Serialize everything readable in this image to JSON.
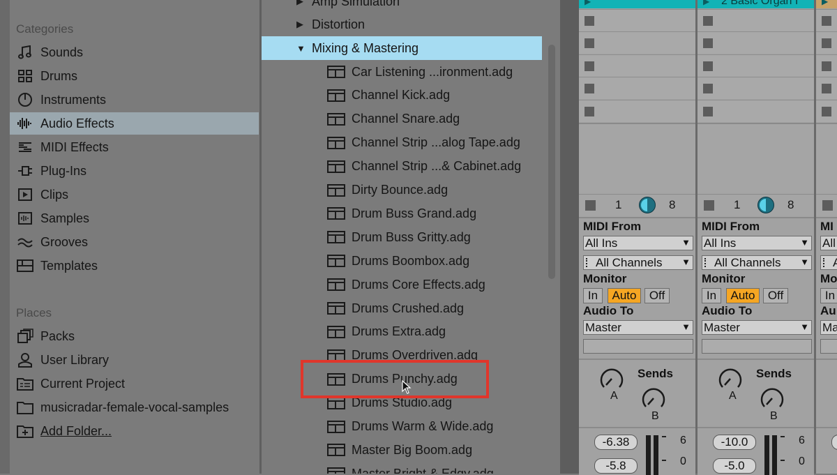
{
  "categories": {
    "heading": "Categories",
    "items": [
      {
        "label": "Sounds",
        "icon": "sounds-icon"
      },
      {
        "label": "Drums",
        "icon": "drums-icon"
      },
      {
        "label": "Instruments",
        "icon": "instruments-icon"
      },
      {
        "label": "Audio Effects",
        "icon": "audio-effects-icon",
        "selected": true
      },
      {
        "label": "MIDI Effects",
        "icon": "midi-effects-icon"
      },
      {
        "label": "Plug-Ins",
        "icon": "plugins-icon"
      },
      {
        "label": "Clips",
        "icon": "clips-icon"
      },
      {
        "label": "Samples",
        "icon": "samples-icon"
      },
      {
        "label": "Grooves",
        "icon": "grooves-icon"
      },
      {
        "label": "Templates",
        "icon": "templates-icon"
      }
    ]
  },
  "places": {
    "heading": "Places",
    "items": [
      {
        "label": "Packs",
        "icon": "packs-icon"
      },
      {
        "label": "User Library",
        "icon": "user-library-icon"
      },
      {
        "label": "Current Project",
        "icon": "current-project-icon"
      },
      {
        "label": "musicradar-female-vocal-samples",
        "icon": "folder-icon"
      },
      {
        "label": "Add Folder...",
        "icon": "add-folder-icon"
      }
    ]
  },
  "browser": {
    "folders": [
      {
        "label": "Amp Simulation",
        "expanded": false
      },
      {
        "label": "Distortion",
        "expanded": false
      },
      {
        "label": "Mixing & Mastering",
        "expanded": true,
        "selected": true
      }
    ],
    "files": [
      "Car Listening ...ironment.adg",
      "Channel Kick.adg",
      "Channel Snare.adg",
      "Channel Strip ...alog Tape.adg",
      "Channel Strip ...& Cabinet.adg",
      "Dirty Bounce.adg",
      "Drum Buss Grand.adg",
      "Drum Buss Gritty.adg",
      "Drums Boombox.adg",
      "Drums Core Effects.adg",
      "Drums Crushed.adg",
      "Drums Extra.adg",
      "Drums Overdriven.adg",
      "Drums Punchy.adg",
      "Drums Studio.adg",
      "Drums Warm & Wide.adg",
      "Master Big Boom.adg",
      "Master Bright & Edgy.adg"
    ],
    "highlighted_file": "Drums Punchy.adg"
  },
  "tracks": [
    {
      "name": "",
      "header_color": "#12b3b6",
      "status_left": "1",
      "status_right": "8",
      "midi_from_label": "MIDI From",
      "midi_from_value": "All Ins",
      "channel_value": "All Channels",
      "monitor_label": "Monitor",
      "monitor_in": "In",
      "monitor_auto": "Auto",
      "monitor_off": "Off",
      "audio_to_label": "Audio To",
      "audio_to_value": "Master",
      "sends_label": "Sends",
      "send_a": "A",
      "send_b": "B",
      "volume": "-6.38",
      "volume2": "-5.8",
      "meter_top": "6",
      "meter_bottom": "0"
    },
    {
      "name": "2 Basic Organ I",
      "header_color": "#12b3b6",
      "status_left": "1",
      "status_right": "8",
      "midi_from_label": "MIDI From",
      "midi_from_value": "All Ins",
      "channel_value": "All Channels",
      "monitor_label": "Monitor",
      "monitor_in": "In",
      "monitor_auto": "Auto",
      "monitor_off": "Off",
      "audio_to_label": "Audio To",
      "audio_to_value": "Master",
      "sends_label": "Sends",
      "send_a": "A",
      "send_b": "B",
      "volume": "-10.0",
      "volume2": "-5.0",
      "meter_top": "6",
      "meter_bottom": "0"
    }
  ],
  "partial_track": {
    "midi_from_label": "MI",
    "midi_from_value": "All",
    "channel_value": "A",
    "monitor_label": "Mo",
    "monitor_in": "In",
    "audio_to_label": "Au",
    "audio_to_value": "Ma"
  }
}
